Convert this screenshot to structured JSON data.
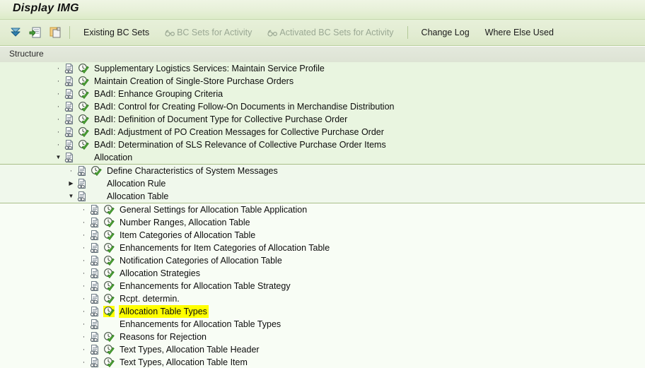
{
  "window": {
    "title": "Display IMG"
  },
  "toolbar": {
    "icons": [
      {
        "name": "collapse-all-icon",
        "glyph": "collapse-all"
      },
      {
        "name": "import-bc-set-icon",
        "glyph": "document-import"
      },
      {
        "name": "copy-icon",
        "glyph": "copy-pages"
      }
    ],
    "buttons": [
      {
        "label": "Existing BC Sets",
        "enabled": true,
        "icon": null
      },
      {
        "label": "BC Sets for Activity",
        "enabled": false,
        "icon": "glasses-icon"
      },
      {
        "label": "Activated BC Sets for Activity",
        "enabled": false,
        "icon": "glasses-icon"
      },
      {
        "label": "Change Log",
        "enabled": true,
        "icon": null
      },
      {
        "label": "Where Else Used",
        "enabled": true,
        "icon": null
      }
    ]
  },
  "column_header": {
    "structure": "Structure"
  },
  "colors": {
    "title_bg": "#e7f0d8",
    "toolbar_bg": "#e2ecd2",
    "band_depth1": "#e9f5e0",
    "band_depth2": "#f0f8ec",
    "band_depth3": "#f8fdf5",
    "band_divider": "#a9bf88",
    "selection_highlight": "#ffff00",
    "disabled_text": "#9aa893"
  },
  "tree": {
    "bands": [
      {
        "depth": 1,
        "indent": 78,
        "rows": [
          {
            "marker": "bullet",
            "doc": true,
            "activity": true,
            "label": "Supplementary Logistics Services: Maintain Service Profile"
          },
          {
            "marker": "bullet",
            "doc": true,
            "activity": true,
            "label": "Maintain Creation of Single-Store Purchase Orders"
          },
          {
            "marker": "bullet",
            "doc": true,
            "activity": true,
            "label": "BAdI: Enhance Grouping Criteria"
          },
          {
            "marker": "bullet",
            "doc": true,
            "activity": true,
            "label": "BAdI: Control for Creating Follow-On Documents in Merchandise Distribution"
          },
          {
            "marker": "bullet",
            "doc": true,
            "activity": true,
            "label": "BAdI: Definition of Document Type for Collective Purchase Order"
          },
          {
            "marker": "bullet",
            "doc": true,
            "activity": true,
            "label": "BAdI: Adjustment of PO Creation Messages for Collective Purchase Order"
          },
          {
            "marker": "bullet",
            "doc": true,
            "activity": true,
            "label": "BAdI: Determination of SLS Relevance of Collective Purchase Order Items"
          },
          {
            "marker": "expanded",
            "doc": true,
            "activity": false,
            "label": "Allocation"
          }
        ]
      },
      {
        "depth": 2,
        "indent": 96,
        "rows": [
          {
            "marker": "bullet",
            "doc": true,
            "activity": true,
            "label": "Define Characteristics of System Messages"
          },
          {
            "marker": "collapsed",
            "doc": true,
            "activity": false,
            "label": "Allocation Rule"
          },
          {
            "marker": "expanded",
            "doc": true,
            "activity": false,
            "label": "Allocation Table"
          }
        ]
      },
      {
        "depth": 3,
        "indent": 114,
        "rows": [
          {
            "marker": "bullet",
            "doc": true,
            "activity": true,
            "label": "General Settings for Allocation Table Application"
          },
          {
            "marker": "bullet",
            "doc": true,
            "activity": true,
            "label": "Number Ranges, Allocation Table"
          },
          {
            "marker": "bullet",
            "doc": true,
            "activity": true,
            "label": "Item Categories of Allocation Table"
          },
          {
            "marker": "bullet",
            "doc": true,
            "activity": true,
            "label": "Enhancements for Item Categories of Allocation Table"
          },
          {
            "marker": "bullet",
            "doc": true,
            "activity": true,
            "label": "Notification Categories of Allocation Table"
          },
          {
            "marker": "bullet",
            "doc": true,
            "activity": true,
            "label": "Allocation Strategies"
          },
          {
            "marker": "bullet",
            "doc": true,
            "activity": true,
            "label": "Enhancements for Allocation Table Strategy"
          },
          {
            "marker": "bullet",
            "doc": true,
            "activity": true,
            "label": "Rcpt. determin."
          },
          {
            "marker": "bullet",
            "doc": true,
            "activity": true,
            "label": "Allocation Table Types",
            "selected": true
          },
          {
            "marker": "bullet",
            "doc": true,
            "activity": false,
            "label": "Enhancements for Allocation Table Types"
          },
          {
            "marker": "bullet",
            "doc": true,
            "activity": true,
            "label": "Reasons for Rejection"
          },
          {
            "marker": "bullet",
            "doc": true,
            "activity": true,
            "label": "Text Types, Allocation Table Header"
          },
          {
            "marker": "bullet",
            "doc": true,
            "activity": true,
            "label": "Text Types, Allocation Table Item"
          }
        ]
      }
    ]
  }
}
